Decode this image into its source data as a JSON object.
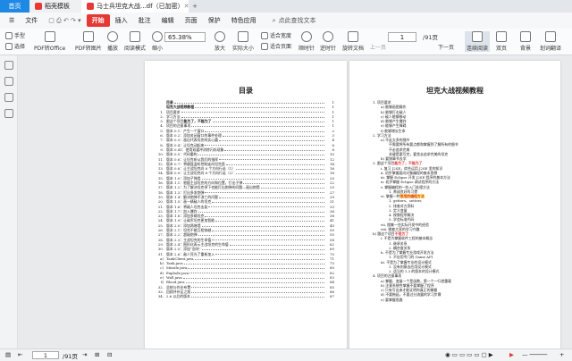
{
  "tabs": {
    "home": "首页",
    "t1": "稻壳模板",
    "t2": "马士兵坦克大战...df（已加密）",
    "plus": "+"
  },
  "menu": {
    "file": "文件",
    "start": "开始",
    "insert": "插入",
    "annot": "批注",
    "edit": "编辑",
    "page": "页面",
    "protect": "保护",
    "feature": "特色应用",
    "search": "点此查找文本"
  },
  "ribbon": {
    "hand": "手型",
    "select": "选择",
    "pdf2office": "PDF转Office",
    "pdf2img": "PDF转图片",
    "play": "播放",
    "read": "阅读模式",
    "shrink": "缩小",
    "zoom": "65.38%",
    "enlarge": "放大",
    "actual": "实际大小",
    "fitwidth": "适合宽度",
    "fitpage": "适合页面",
    "clockwise": "顺时针",
    "ccw": "逆时针",
    "rotate": "旋转文档",
    "prev": "上一页",
    "page": "1",
    "total": "/91页",
    "next": "下一页",
    "cont": "连续阅读",
    "double": "双页",
    "bg": "背景",
    "split": "划词翻译"
  },
  "status": {
    "page": "1",
    "total": "/91页"
  },
  "left_page": {
    "title": "目录",
    "toc": [
      {
        "n": "",
        "t": "目录",
        "p": "1",
        "b": true
      },
      {
        "n": "",
        "t": "坦克大战视频教程",
        "p": "1",
        "b": true
      },
      {
        "n": "1.",
        "t": "项目要求",
        "p": "1"
      },
      {
        "n": "2.",
        "t": "学习方法",
        "p": "1"
      },
      {
        "n": "3.",
        "t": "跟这个项目",
        "p": "1",
        "hl": "能为了，不能为了"
      },
      {
        "n": "4.",
        "t": "项目的注意事项",
        "p": "1"
      },
      {
        "n": "5.",
        "t": "版本 0.1：产生一个窗口",
        "p": "2"
      },
      {
        "n": "6.",
        "t": "版本 0.2：添加关闭窗口的事件处理",
        "p": "3"
      },
      {
        "n": "7.",
        "t": "版本 0.3：画出代表坦克的实心圆",
        "p": "4"
      },
      {
        "n": "8.",
        "t": "版本 0.4：让坦克动起来",
        "p": "6"
      },
      {
        "n": "9.",
        "t": "版本 0.41：使用双缓冲消除闪烁现象",
        "p": "8"
      },
      {
        "n": "10.",
        "t": "版本 0.5：代码重构",
        "p": "10"
      },
      {
        "n": "11.",
        "t": "版本 0.6：让坦克听从我们的指挥",
        "p": "12"
      },
      {
        "n": "12.",
        "t": "版本 0.7：将键盘监听控制走向坦克类",
        "p": "14"
      },
      {
        "n": "13.",
        "t": "版本 0.8：让主战坦克向 8 个方向行走（1）",
        "p": "16"
      },
      {
        "n": "14.",
        "t": "版本 0.9：让主战坦克向 8 个方向行走（2）",
        "p": "18"
      },
      {
        "n": "15.",
        "t": "版本 1.0：添加子弹类",
        "p": "20"
      },
      {
        "n": "16.",
        "t": "版本 1.1：根据主战坦克的方向和位置，打出子弹",
        "p": "22"
      },
      {
        "n": "17.",
        "t": "版本 1.2：为了解决坦克停下也能打出炮弹的问题—画出炮筒",
        "p": "25"
      },
      {
        "n": "18.",
        "t": "版本 1.3：打出多发炮弹",
        "p": "27"
      },
      {
        "n": "19.",
        "t": "版本 1.4：解决炮弹不消亡的问题",
        "p": "29"
      },
      {
        "n": "20.",
        "t": "版本 1.5：画一辆敌人的坦克",
        "p": "31"
      },
      {
        "n": "21.",
        "t": "版本 1.6：将敌人坦克击毙",
        "p": "33"
      },
      {
        "n": "22.",
        "t": "版本 1.7：加入爆炸",
        "p": "36"
      },
      {
        "n": "23.",
        "t": "版本 1.8：添加多辆坦克",
        "p": "38"
      },
      {
        "n": "24.",
        "t": "版本 1.9：让敌军坦克更加智能",
        "p": "41"
      },
      {
        "n": "25.",
        "t": "版本 2.0：添加两堵墙",
        "p": "45"
      },
      {
        "n": "26.",
        "t": "版本 2.1：坦克不能互相穿越",
        "p": "50"
      },
      {
        "n": "27.",
        "t": "版本 2.2：超级炮弹",
        "p": "55"
      },
      {
        "n": "28.",
        "t": "版本 2.3：主战坦克的生命值",
        "p": "58"
      },
      {
        "n": "29.",
        "t": "版本 2.4：图形化表示主战坦克的生命值",
        "p": "62"
      },
      {
        "n": "30.",
        "t": "版本 2.5：添加“血块”",
        "p": "65"
      },
      {
        "n": "31.",
        "t": "版本 2.6：敌人死光了重新加入",
        "p": "70"
      },
      {
        "n": "a)",
        "t": "TankClient.java",
        "p": "71"
      },
      {
        "n": "b)",
        "t": "Tank.java",
        "p": "75"
      },
      {
        "n": "c)",
        "t": "Missile.java",
        "p": "80"
      },
      {
        "n": "d)",
        "t": "Explode.java",
        "p": "82"
      },
      {
        "n": "e)",
        "t": "Wall.java",
        "p": "83"
      },
      {
        "n": "f)",
        "t": "Blood.java",
        "p": "84"
      },
      {
        "n": "32.",
        "t": "总结与作业布置",
        "p": "85"
      },
      {
        "n": "33.",
        "t": "回顾并补足之前",
        "p": "86"
      },
      {
        "n": "34.",
        "t": "2.6 以后的版本",
        "p": "87"
      }
    ]
  },
  "right_page": {
    "title": "坦克大战视频教程",
    "outline": [
      {
        "i": 0,
        "t": "1.  项目要求"
      },
      {
        "i": 1,
        "t": "a)  能够画图操作"
      },
      {
        "i": 1,
        "t": "b)  能够打击敌人"
      },
      {
        "i": 1,
        "t": "c)  敌人能够移动"
      },
      {
        "i": 1,
        "t": "d)  能够产生爆炸"
      },
      {
        "i": 1,
        "t": "e)  能够产生障碍"
      },
      {
        "i": 1,
        "t": "f)  能够增长生命"
      },
      {
        "i": 0,
        "t": "2.  学习方法"
      },
      {
        "i": 1,
        "t": "a)  不走太多的细节"
      },
      {
        "i": 2,
        "t": "不需要将所有要点都和掌握到了解所有的细节"
      },
      {
        "i": 2,
        "t": "不必追求完美"
      },
      {
        "i": 2,
        "t": "关键是要写完，要舍去追求完美的坦克"
      },
      {
        "i": 1,
        "t": "b)  要按章节去学"
      },
      {
        "i": 0,
        "t": "3.  跟这个项目",
        "hl": "能为了，不能为了"
      },
      {
        "i": 1,
        "t": "i.   复习 J2SE，综合运用 J2SE 里的知识"
      },
      {
        "i": 1,
        "t": "ii.  初步掌握面向对象编程的基本思想"
      },
      {
        "i": 1,
        "t": "iii. 掌握 Eclipse 开发 J2SE 程序的基本方法"
      },
      {
        "i": 1,
        "t": "iv.  初步掌握 Eclipse 调试程序的方法"
      },
      {
        "i": 1,
        "t": "v.   掌握编程的一些入门处理方法"
      },
      {
        "i": 2,
        "t": "1.  养成良好的习惯"
      },
      {
        "i": 1,
        "t": "vi.  掌握一种",
        "hl2": "常用的编程方法"
      },
      {
        "i": 2,
        "t": "1.  getters、setters"
      },
      {
        "i": 2,
        "t": "2.  排查对方资料"
      },
      {
        "i": 2,
        "t": "3.  定义变量"
      },
      {
        "i": 2,
        "t": "4.  按需程序解决"
      },
      {
        "i": 2,
        "t": "5.  学会标准代码"
      },
      {
        "i": 1,
        "t": "vii. 搜集一些实际开发中的经验"
      },
      {
        "i": 1,
        "t": "viii. 微复大家的学习兴趣"
      },
      {
        "i": 0,
        "t": "b)  跟这个项目",
        "hl": "不是为了"
      },
      {
        "i": 1,
        "t": "i.   不是为掌握软件工程的基本概念"
      },
      {
        "i": 2,
        "t": "1.  继承关系"
      },
      {
        "i": 2,
        "t": "2.  耦合度关系"
      },
      {
        "i": 1,
        "t": "ii.  不是为了掌握专业游戏开发方法"
      },
      {
        "i": 2,
        "t": "1.  不应用专门的 Game API"
      },
      {
        "i": 1,
        "t": "iii. 不是为了掌握专业的设计模式"
      },
      {
        "i": 2,
        "t": "1.  没有刻意去应用设计模式"
      },
      {
        "i": 2,
        "t": "2.  适当的 1.3 的版本的设计模式"
      },
      {
        "i": 0,
        "t": "4.  项目的注意事项"
      },
      {
        "i": 1,
        "t": "a)  掌握、变量一个是函数，第一个一行就重载"
      },
      {
        "i": 1,
        "t": "b)  注意系统性掌握不要掌握了程序"
      },
      {
        "i": 1,
        "t": "c)  只有写出来才能证明你真正的掌握"
      },
      {
        "i": 1,
        "t": "d)  不要拖延，不要过分流露的学习步骤"
      },
      {
        "i": 1,
        "t": "e)  要掌握思路"
      }
    ]
  }
}
